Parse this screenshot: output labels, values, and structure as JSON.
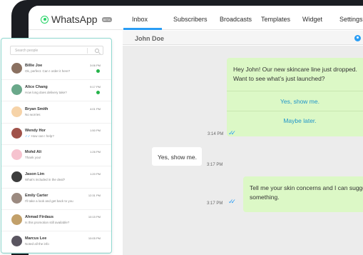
{
  "app": {
    "name": "WhatsApp",
    "badge": "BETA"
  },
  "nav": {
    "items": [
      "Inbox",
      "Subscribers",
      "Broadcasts",
      "Templates",
      "Widget",
      "Settings"
    ],
    "active": "Inbox"
  },
  "chat": {
    "contact_name": "John Doe",
    "messages": [
      {
        "direction": "out",
        "text_line1": "Hey John! Our new skincare line just dropped.",
        "text_line2": "Want to see what’s just launched?",
        "quick_replies": [
          "Yes, show me.",
          "Maybe later."
        ],
        "time": "3:14 PM",
        "status": "read"
      },
      {
        "direction": "in",
        "text": "Yes, show me.",
        "time": "3:17 PM"
      },
      {
        "direction": "out",
        "text_line1": "Tell me your skin concerns and I can suggest",
        "text_line2": "something.",
        "time": "3:17 PM",
        "status": "read"
      }
    ]
  },
  "contacts_panel": {
    "search_placeholder": "Search people",
    "contacts": [
      {
        "name": "Billie Joe",
        "message": "Ok, perfect. Can I order it here?",
        "time": "3:06 PM",
        "unread": true,
        "avatar_color": "#8a7060"
      },
      {
        "name": "Alice Chang",
        "message": "How long does delivery take?",
        "time": "9:17 PM",
        "unread": true,
        "avatar_color": "#6aa88a"
      },
      {
        "name": "Bryan Smith",
        "message": "No worries",
        "time": "4:01 PM",
        "unread": false,
        "avatar_color": "#f6d3a8"
      },
      {
        "name": "Wendy Hor",
        "message": "How can I help?",
        "time": "1:50 PM",
        "unread": false,
        "sent": true,
        "avatar_color": "#a0524a"
      },
      {
        "name": "Mohd Ali",
        "message": "Thank you!",
        "time": "1:26 PM",
        "unread": false,
        "avatar_color": "#f6c3cf"
      },
      {
        "name": "Jason Lim",
        "message": "What's included in the deal?",
        "time": "1:20 PM",
        "unread": false,
        "avatar_color": "#3c3c3c"
      },
      {
        "name": "Emily Carter",
        "message": "I'll take a look and get back to you",
        "time": "12:31 PM",
        "unread": false,
        "avatar_color": "#9b8a80"
      },
      {
        "name": "Ahmad Firdaus",
        "message": "Is this promotion still available?",
        "time": "10:15 PM",
        "unread": false,
        "avatar_color": "#c2a06a"
      },
      {
        "name": "Marcus Lee",
        "message": "Noted all the info",
        "time": "10:05 PM",
        "unread": false,
        "avatar_color": "#5a5560"
      }
    ]
  }
}
